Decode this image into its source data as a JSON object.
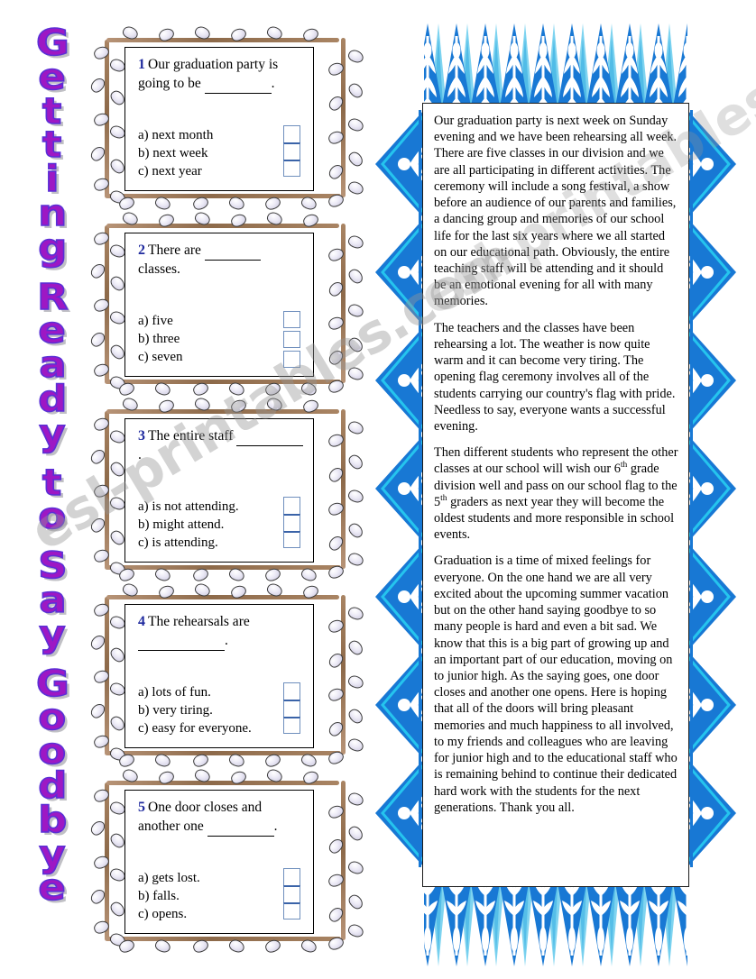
{
  "worksheet": {
    "title": "Getting Ready to Say Goodbye",
    "title_letters": [
      "G",
      "e",
      "t",
      "t",
      "i",
      "n",
      "g",
      "",
      "R",
      "e",
      "a",
      "d",
      "y",
      "",
      "t",
      "o",
      "",
      "S",
      "a",
      "y",
      "",
      "G",
      "o",
      "o",
      "d",
      "b",
      "y",
      "e"
    ],
    "watermark": "esl-printables.com",
    "colors": {
      "title_fill": "#9d18c4",
      "title_outline": "#5a2fd6",
      "question_number": "#1f2a9e",
      "checkbox_border": "#6f8fbd",
      "checkbox_divider": "#3a63a8",
      "branch": "#8d6a4a",
      "bud": "#eceaf6",
      "deco_blue_dark": "#1878d4",
      "deco_blue_mid": "#2ba8e0",
      "deco_blue_light": "#7fd4f0",
      "deco_cyan": "#25c4ee"
    }
  },
  "questions": [
    {
      "number": "1",
      "prompt_before": "Our graduation party is going to be",
      "prompt_after": ".",
      "options": [
        "a) next month",
        "b) next week",
        "c) next year"
      ],
      "box_style": "joined"
    },
    {
      "number": "2",
      "prompt_before": "There are",
      "prompt_mid": "classes.",
      "prompt_after": "",
      "options": [
        "a) five",
        "b) three",
        "c) seven"
      ],
      "box_style": "gapped"
    },
    {
      "number": "3",
      "prompt_before": "The entire staff",
      "prompt_after": ".",
      "options": [
        "a) is not attending.",
        "b) might attend.",
        "c) is attending."
      ],
      "box_style": "joined"
    },
    {
      "number": "4",
      "prompt_before": "The rehearsals are",
      "prompt_after": ".",
      "options": [
        "a) lots of fun.",
        "b) very tiring.",
        "c) easy for everyone."
      ],
      "box_style": "joined"
    },
    {
      "number": "5",
      "prompt_before": "One door closes and another one",
      "prompt_after": ".",
      "options": [
        "a) gets lost.",
        "b) falls.",
        "c) opens."
      ],
      "box_style": "joined"
    }
  ],
  "reading": {
    "paragraphs": [
      "Our graduation party is next week on Sunday evening and we have been rehearsing all week. There are five classes in our division and we are all participating in different activities. The ceremony will include a song festival, a show before an audience of our parents and families, a dancing group and memories of our school life for the last six years where we all started on our educational path. Obviously, the entire teaching staff will be attending and it should be an emotional evening for all with many memories.",
      "The teachers and the classes have been rehearsing a lot. The weather is now quite warm and it can become very tiring. The opening flag ceremony involves all of the students carrying our country's flag with pride. Needless to say, everyone wants a successful evening.",
      "Graduation is a time of mixed feelings for everyone. On the one hand we are all very excited about the upcoming summer vacation but on the other hand saying goodbye to so many people is hard and even a bit sad. We know that this is a big part of growing up and an important part of our education, moving on to junior high. As the saying goes, one door closes and another one opens. Here is hoping that all of the doors will bring pleasant memories and much happiness to all involved, to my friends and colleagues who are leaving for junior high and to the educational staff who is remaining behind to continue their dedicated hard work with the students for the next generations. Thank you all."
    ],
    "paragraph3_parts": {
      "a": "Then different students who represent the other classes at our school  will wish our 6",
      "sup1": "th",
      "b": " grade division well and pass on our school flag to the 5",
      "sup2": "th",
      "c": " graders as next year they will become the oldest students and more responsible in school events."
    }
  }
}
